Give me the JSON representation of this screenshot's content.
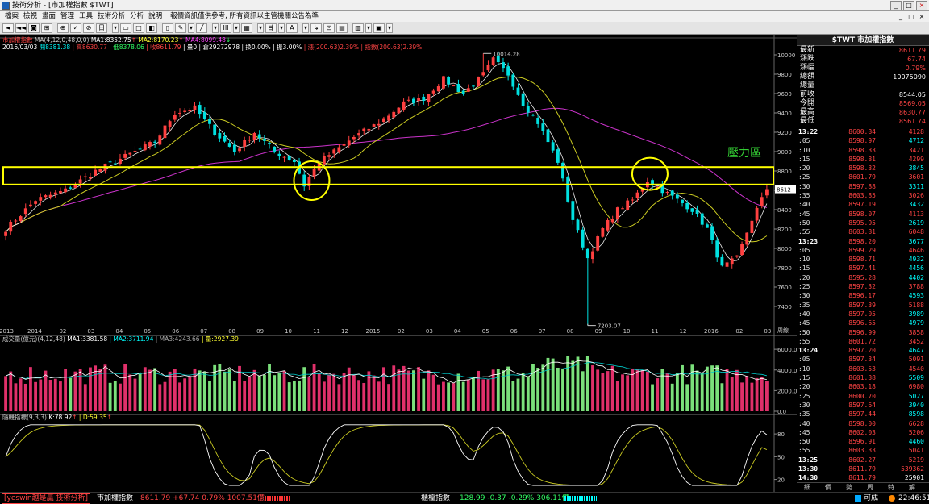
{
  "window": {
    "title": "技術分析 - [市加權指數 $TWT]",
    "controls": [
      "_",
      "□",
      "×"
    ]
  },
  "menu": {
    "items": [
      "檔案",
      "檢視",
      "畫面",
      "管理",
      "工具",
      "技術分析",
      "分析",
      "說明"
    ],
    "notice": "報價資訊僅供參考, 所有資訊以主管機關公告為準",
    "mdi": [
      "_",
      "□",
      "×"
    ]
  },
  "toolbar": {
    "buttons": [
      "◄",
      "◄◄",
      "◙",
      "⊞",
      "⊕",
      "✓",
      "⊘",
      "日",
      "▾",
      "▭",
      "□",
      "◧",
      "▯",
      "✎",
      "▾",
      "╱",
      "▾",
      "III",
      "▾",
      "▦",
      "▾",
      "⇶",
      "▾",
      "A",
      "▾",
      "↳",
      "⊡",
      "▤",
      "▥",
      "▾",
      "▣",
      "▾"
    ]
  },
  "indicators": {
    "main_line1": [
      {
        "t": "市加權指數",
        "c": "#ff4444"
      },
      {
        "t": " MA(4,12,0,48,0,0) ",
        "c": "#ccc"
      },
      {
        "t": "MA1:8352.75",
        "c": "#fff"
      },
      {
        "t": "↑",
        "c": "#ff4444"
      },
      {
        "t": " MA2:8170.23",
        "c": "#ffff33"
      },
      {
        "t": "↑",
        "c": "#ff4444"
      },
      {
        "t": " MA4:8099.48",
        "c": "#ff44ff"
      },
      {
        "t": "↓",
        "c": "#33ff66"
      }
    ],
    "main_line2": [
      {
        "t": "2016/03/03 ",
        "c": "#fff"
      },
      {
        "t": "開8381.38",
        "c": "#00ffff"
      },
      {
        "t": " | 高8630.77",
        "c": "#ff4444"
      },
      {
        "t": " | 低8378.06",
        "c": "#33ff66"
      },
      {
        "t": " | 收8611.79",
        "c": "#ff4444"
      },
      {
        "t": " | 量0 ",
        "c": "#fff"
      },
      {
        "t": "| 倉29272978",
        "c": "#fff"
      },
      {
        "t": " | 換0.00%",
        "c": "#fff"
      },
      {
        "t": " | 振3.00%",
        "c": "#fff"
      },
      {
        "t": " | 漲(200.63)2.39%",
        "c": "#ff4444"
      },
      {
        "t": " | 指數(200.63)2.39%",
        "c": "#ff4444"
      }
    ],
    "volume_line": [
      {
        "t": "成交量(億元)(4,12,48) ",
        "c": "#ccc"
      },
      {
        "t": "MA1:3381.58",
        "c": "#fff"
      },
      {
        "t": " | MA2:3711.94",
        "c": "#00ffff"
      },
      {
        "t": " | MA3:4243.66",
        "c": "#aaa"
      },
      {
        "t": " | 量:2927.39",
        "c": "#ffff33"
      }
    ],
    "kd_line": [
      {
        "t": "隨機指標(9,3,3) ",
        "c": "#ccc"
      },
      {
        "t": "K:78.92",
        "c": "#fff"
      },
      {
        "t": "↑",
        "c": "#ff4444"
      },
      {
        "t": " | D:59.35",
        "c": "#ffff33"
      },
      {
        "t": "↑",
        "c": "#ff4444"
      }
    ]
  },
  "chart_data": [
    {
      "type": "candlestick",
      "title": "市加權指數",
      "ylim": [
        7200,
        10100
      ],
      "y_ticks": [
        7400,
        7600,
        7800,
        8000,
        8200,
        8400,
        8600,
        8800,
        9000,
        9200,
        9400,
        9600,
        9800,
        10000
      ],
      "x_labels": [
        "2013",
        "2014",
        "02",
        "03",
        "04",
        "05",
        "06",
        "07",
        "08",
        "09",
        "10",
        "11",
        "12",
        "2015",
        "02",
        "03",
        "04",
        "05",
        "06",
        "07",
        "08",
        "09",
        "10",
        "11",
        "12",
        "2016",
        "02",
        "03"
      ],
      "annotations": {
        "high": "10014.28",
        "low": "7203.07",
        "resistance_label": "壓力區",
        "last_price_tag": "8612",
        "resistance_band": [
          8660,
          8840
        ]
      },
      "ma_series": [
        "MA1",
        "MA2",
        "MA4"
      ],
      "anchors": [
        [
          0,
          8200
        ],
        [
          6,
          8500
        ],
        [
          12,
          8600
        ],
        [
          18,
          8800
        ],
        [
          22,
          8900
        ],
        [
          26,
          9000
        ],
        [
          30,
          9100
        ],
        [
          34,
          9400
        ],
        [
          38,
          9450
        ],
        [
          42,
          9200
        ],
        [
          46,
          9000
        ],
        [
          50,
          9200
        ],
        [
          54,
          9000
        ],
        [
          58,
          8900
        ],
        [
          60,
          8650
        ],
        [
          63,
          8900
        ],
        [
          66,
          9000
        ],
        [
          70,
          9150
        ],
        [
          75,
          9300
        ],
        [
          80,
          9500
        ],
        [
          84,
          9550
        ],
        [
          88,
          9750
        ],
        [
          92,
          9600
        ],
        [
          96,
          9800
        ],
        [
          98,
          9950
        ],
        [
          101,
          9800
        ],
        [
          104,
          9500
        ],
        [
          107,
          9300
        ],
        [
          111,
          8900
        ],
        [
          114,
          8300
        ],
        [
          117,
          7900
        ],
        [
          120,
          8200
        ],
        [
          123,
          8400
        ],
        [
          126,
          8500
        ],
        [
          129,
          8700
        ],
        [
          132,
          8600
        ],
        [
          135,
          8500
        ],
        [
          138,
          8400
        ],
        [
          141,
          8200
        ],
        [
          144,
          7800
        ],
        [
          147,
          7900
        ],
        [
          150,
          8300
        ],
        [
          153,
          8612
        ]
      ]
    },
    {
      "type": "bar",
      "title": "成交量",
      "ylim": [
        0,
        6400
      ],
      "y_ticks": [
        0,
        2000,
        4000,
        6000
      ],
      "last": 2927.39
    },
    {
      "type": "line",
      "title": "隨機指標",
      "ylim": [
        10,
        95
      ],
      "y_ticks": [
        20,
        50,
        80
      ],
      "series": [
        {
          "name": "K",
          "last": 78.92
        },
        {
          "name": "D",
          "last": 59.35
        }
      ]
    }
  ],
  "quote": {
    "header": "$TWT 市加權指數",
    "rows": [
      {
        "l": "最新",
        "v": "8611.79",
        "c": "#ff4444"
      },
      {
        "l": "漲跌",
        "v": "67.74",
        "c": "#ff4444"
      },
      {
        "l": "漲幅",
        "v": "0.79%",
        "c": "#ff4444"
      },
      {
        "l": "總額",
        "v": "10075090",
        "c": "#fff"
      },
      {
        "l": "總量",
        "v": "",
        "c": "#fff"
      },
      {
        "l": "前收",
        "v": "8544.05",
        "c": "#fff"
      },
      {
        "l": "今開",
        "v": "8569.05",
        "c": "#ff4444"
      },
      {
        "l": "最高",
        "v": "8630.77",
        "c": "#ff4444"
      },
      {
        "l": "最低",
        "v": "8561.74",
        "c": "#ff4444"
      }
    ]
  },
  "ticks": [
    {
      "t": "13:22",
      "h": true,
      "p": "8600.84",
      "q": "4128",
      "qc": "#ff4444"
    },
    {
      "t": ":05",
      "p": "8598.97",
      "q": "4712",
      "qc": "#00ffff"
    },
    {
      "t": ":10",
      "p": "8598.33",
      "q": "3421",
      "qc": "#ff4444"
    },
    {
      "t": ":15",
      "p": "8598.81",
      "q": "4299",
      "qc": "#ff4444"
    },
    {
      "t": ":20",
      "p": "8598.32",
      "q": "3845",
      "qc": "#00ffff"
    },
    {
      "t": ":25",
      "p": "8601.79",
      "q": "3601",
      "qc": "#ff4444"
    },
    {
      "t": ":30",
      "p": "8597.88",
      "q": "3311",
      "qc": "#00ffff"
    },
    {
      "t": ":35",
      "p": "8603.85",
      "q": "3026",
      "qc": "#ff4444"
    },
    {
      "t": ":40",
      "p": "8597.19",
      "q": "3432",
      "qc": "#00ffff"
    },
    {
      "t": ":45",
      "p": "8598.07",
      "q": "4113",
      "qc": "#ff4444"
    },
    {
      "t": ":50",
      "p": "8595.95",
      "q": "2619",
      "qc": "#00ffff"
    },
    {
      "t": ":55",
      "p": "8603.81",
      "q": "6048",
      "qc": "#ff4444"
    },
    {
      "t": "13:23",
      "h": true,
      "p": "8598.20",
      "q": "3677",
      "qc": "#00ffff"
    },
    {
      "t": ":05",
      "p": "8599.29",
      "q": "4646",
      "qc": "#ff4444"
    },
    {
      "t": ":10",
      "p": "8598.71",
      "q": "4932",
      "qc": "#00ffff"
    },
    {
      "t": ":15",
      "p": "8597.41",
      "q": "4456",
      "qc": "#00ffff"
    },
    {
      "t": ":20",
      "p": "8595.28",
      "q": "4402",
      "qc": "#00ffff"
    },
    {
      "t": ":25",
      "p": "8597.32",
      "q": "3788",
      "qc": "#ff4444"
    },
    {
      "t": ":30",
      "p": "8596.17",
      "q": "4593",
      "qc": "#00ffff"
    },
    {
      "t": ":35",
      "p": "8597.39",
      "q": "5188",
      "qc": "#ff4444"
    },
    {
      "t": ":40",
      "p": "8597.05",
      "q": "3989",
      "qc": "#00ffff"
    },
    {
      "t": ":45",
      "p": "8596.65",
      "q": "4979",
      "qc": "#00ffff"
    },
    {
      "t": ":50",
      "p": "8596.99",
      "q": "3858",
      "qc": "#ff4444"
    },
    {
      "t": ":55",
      "p": "8601.72",
      "q": "3452",
      "qc": "#ff4444"
    },
    {
      "t": "13:24",
      "h": true,
      "p": "8597.20",
      "q": "4647",
      "qc": "#00ffff"
    },
    {
      "t": ":05",
      "p": "8597.34",
      "q": "5091",
      "qc": "#ff4444"
    },
    {
      "t": ":10",
      "p": "8603.53",
      "q": "4540",
      "qc": "#ff4444"
    },
    {
      "t": ":15",
      "p": "8601.38",
      "q": "5509",
      "qc": "#00ffff"
    },
    {
      "t": ":20",
      "p": "8603.18",
      "q": "6980",
      "qc": "#ff4444"
    },
    {
      "t": ":25",
      "p": "8600.70",
      "q": "5027",
      "qc": "#00ffff"
    },
    {
      "t": ":30",
      "p": "8597.64",
      "q": "3940",
      "qc": "#00ffff"
    },
    {
      "t": ":35",
      "p": "8597.44",
      "q": "8598",
      "qc": "#00ffff"
    },
    {
      "t": ":40",
      "p": "8598.00",
      "q": "6628",
      "qc": "#ff4444"
    },
    {
      "t": ":45",
      "p": "8602.03",
      "q": "5206",
      "qc": "#ff4444"
    },
    {
      "t": ":50",
      "p": "8596.91",
      "q": "4460",
      "qc": "#00ffff"
    },
    {
      "t": ":55",
      "p": "8603.33",
      "q": "5041",
      "qc": "#ff4444"
    },
    {
      "t": "13:25",
      "h": true,
      "p": "8602.27",
      "q": "5219",
      "qc": "#ff4444"
    },
    {
      "t": "13:30",
      "h": true,
      "p": "8611.79",
      "q": "539362",
      "qc": "#ff4444"
    },
    {
      "t": "14:30",
      "h": true,
      "p": "8611.79",
      "q": "25901",
      "qc": "#fff"
    }
  ],
  "tabs": [
    "細",
    "價",
    "勢",
    "周",
    "特",
    "解"
  ],
  "status": {
    "brand": "[yeswin越是贏 技術分析]",
    "idx1_name": "市加權指數",
    "idx1_vals": "8611.79 +67.74 0.79% 1007.51億",
    "idx2_name": "櫃檯指數",
    "idx2_vals": "128.99 -0.37 -0.29% 306.11億",
    "conn": "可成",
    "time": "22:46:51"
  }
}
